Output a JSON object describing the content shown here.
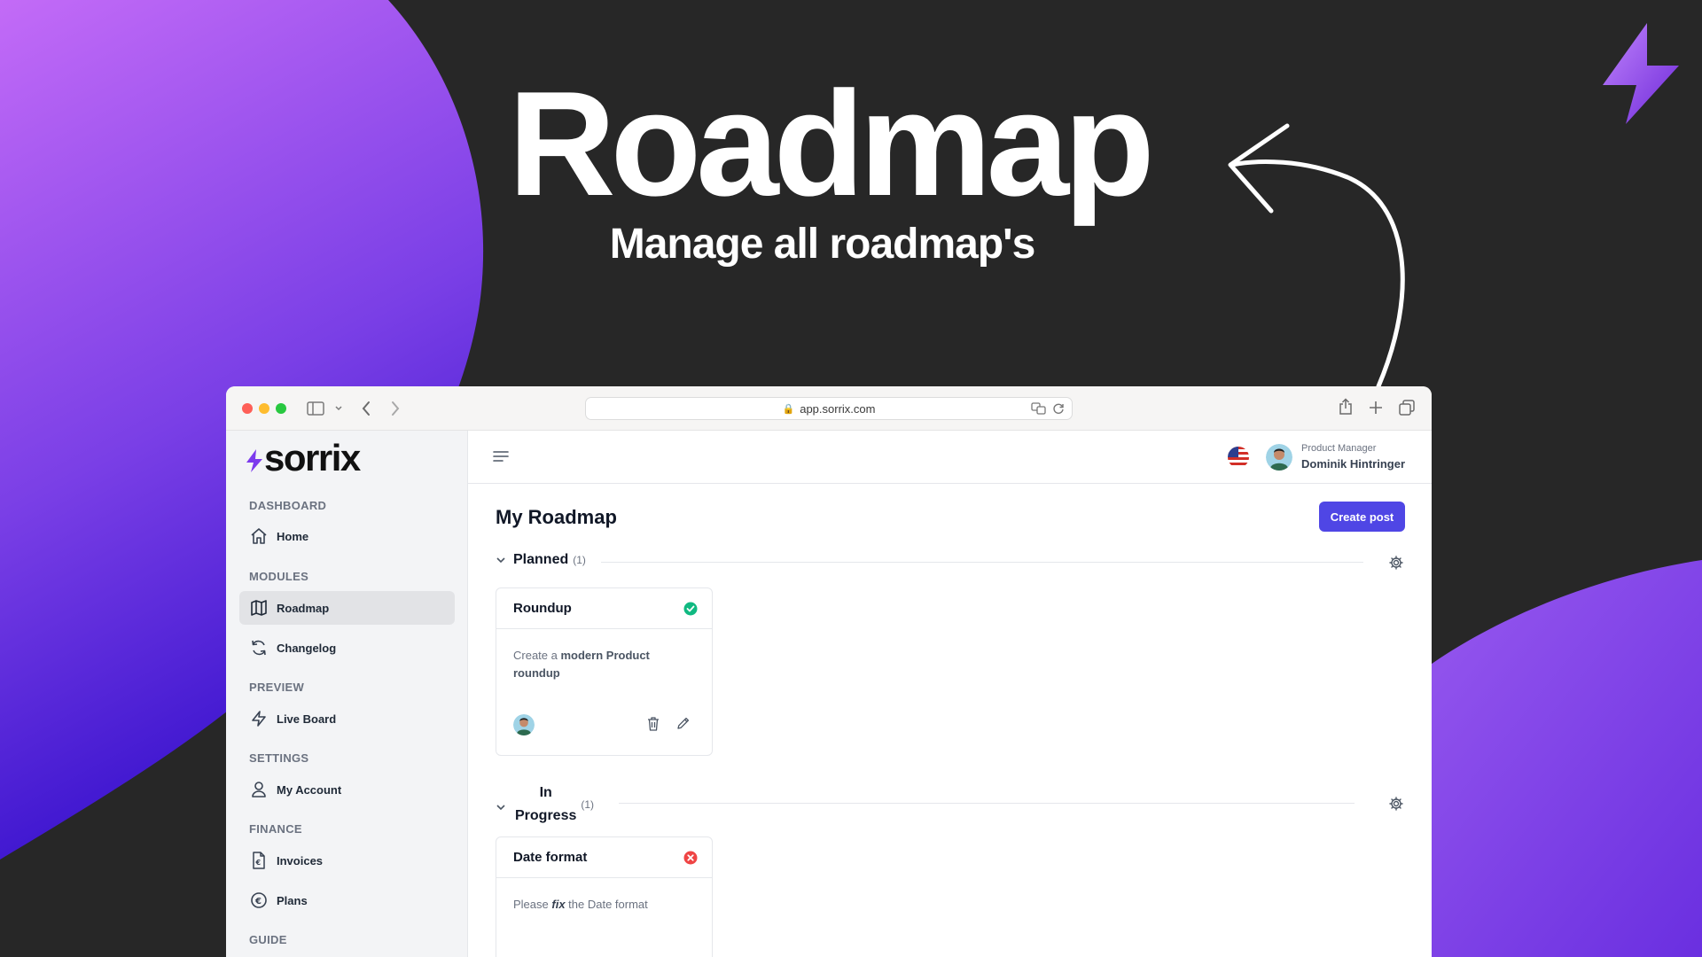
{
  "hero": {
    "title": "Roadmap",
    "subtitle": "Manage all roadmap's"
  },
  "browser": {
    "url": "app.sorrix.com"
  },
  "sidebar": {
    "brand": "sorrix",
    "sections": {
      "dashboard": "DASHBOARD",
      "modules": "MODULES",
      "preview": "PREVIEW",
      "settings": "SETTINGS",
      "finance": "FINANCE",
      "guide": "GUIDE"
    },
    "items": {
      "home": "Home",
      "roadmap": "Roadmap",
      "changelog": "Changelog",
      "live_board": "Live Board",
      "my_account": "My Account",
      "invoices": "Invoices",
      "plans": "Plans"
    }
  },
  "header": {
    "user_role": "Product Manager",
    "user_name": "Dominik Hintringer"
  },
  "main": {
    "page_title": "My Roadmap",
    "create_button": "Create post",
    "groups": [
      {
        "title": "Planned",
        "count": "(1)",
        "cards": [
          {
            "title": "Roundup",
            "status": "done",
            "desc_pre": "Create a ",
            "desc_bold": "modern Product roundup"
          }
        ]
      },
      {
        "title_line1": "In",
        "title_line2": "Progress",
        "count": "(1)",
        "cards": [
          {
            "title": "Date format",
            "status": "error",
            "desc_pre": "Please ",
            "desc_em": "fix",
            "desc_post": " the Date format"
          }
        ]
      }
    ]
  },
  "colors": {
    "background": "#272727",
    "accent": "#4f46e5",
    "success": "#10b981",
    "danger": "#ef4444",
    "purple_gradient_top": "#c36bf7",
    "purple_gradient_bottom": "#3a0fd0"
  },
  "icons": [
    "bolt-icon",
    "home-icon",
    "map-icon",
    "refresh-icon",
    "lightning-icon",
    "user-icon",
    "invoice-icon",
    "euro-icon",
    "gear-icon",
    "trash-icon",
    "pencil-icon",
    "chevron-down-icon",
    "menu-icon",
    "check-circle-icon",
    "x-circle-icon"
  ]
}
